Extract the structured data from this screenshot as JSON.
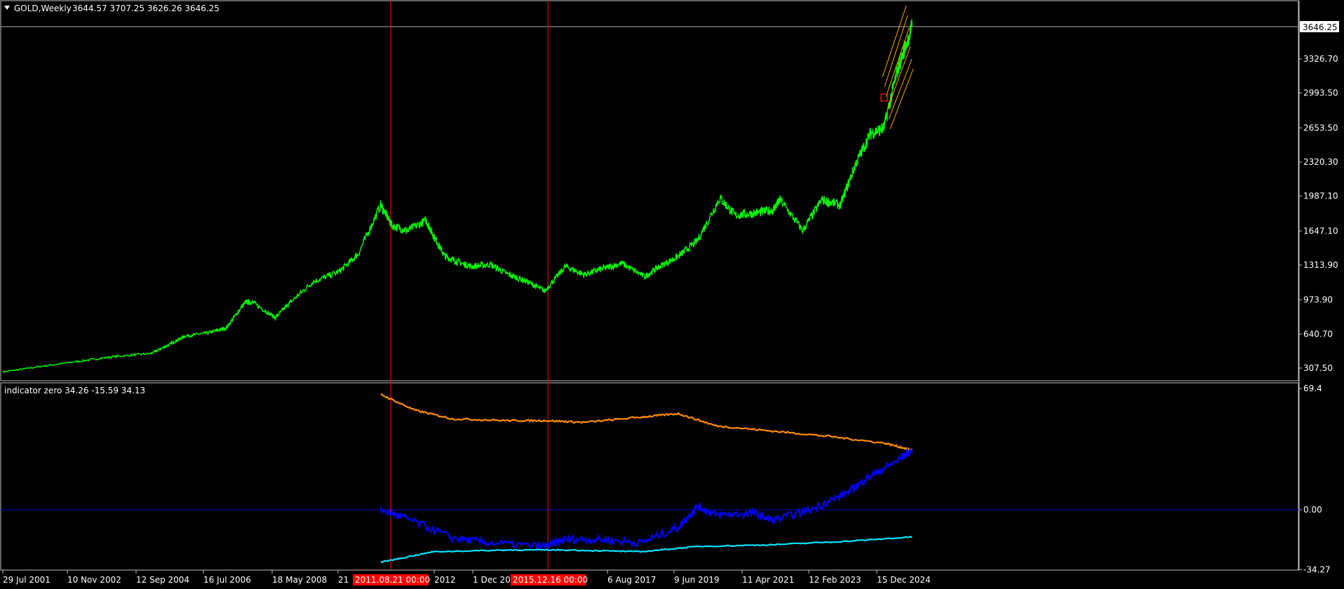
{
  "main_chart": {
    "symbol_label": "GOLD,Weekly",
    "ohlc_label": "3644.57 3707.25 3626.26 3646.25",
    "current_price_label": "3646.25",
    "price_ticks": [
      "3326.70",
      "2993.50",
      "2653.50",
      "2320.30",
      "1987.10",
      "1647.10",
      "1313.90",
      "973.90",
      "640.70",
      "307.50"
    ],
    "price_tick_values": [
      3326.7,
      2993.5,
      2653.5,
      2320.3,
      1987.1,
      1647.1,
      1313.9,
      973.9,
      640.7,
      307.5
    ],
    "colors": {
      "background": "#000000",
      "price": "#00ff00",
      "channel": "#ffa500",
      "vline": "#ff0000",
      "marker": "#cc2200",
      "frame": "#c0c0c0"
    }
  },
  "indicator": {
    "label": "indicator zero 34.26 -15.59 34.13",
    "ticks": [
      "69.4",
      "0.00",
      "-34.27"
    ],
    "tick_values": [
      69.4,
      0.0,
      -34.27
    ],
    "colors": {
      "orange": "#ff8c00",
      "blue": "#0000ff",
      "cyan": "#00e5ff",
      "zero_line": "#0000c8"
    }
  },
  "time_axis": {
    "labels": [
      "29 Jul 2001",
      "10 Nov 2002",
      "12 Sep 2004",
      "16 Jul 2006",
      "18 May 2008",
      "21",
      "2012",
      "1 Dec 20",
      "6 Aug 2017",
      "9 Jun 2019",
      "11 Apr 2021",
      "12 Feb 2023",
      "15 Dec 2024"
    ],
    "highlight_labels": [
      "2011.08.21 00:00",
      "2015.12.16 00:00"
    ],
    "highlight_color": "#ff0000"
  },
  "chart_data": [
    {
      "type": "line",
      "title": "GOLD,Weekly",
      "series": [
        {
          "name": "GOLD,Weekly",
          "x": [
            2001.57,
            2002.5,
            2003.5,
            2004.5,
            2005.5,
            2006.0,
            2006.4,
            2007.0,
            2007.5,
            2008.0,
            2008.2,
            2008.8,
            2009.2,
            2009.8,
            2010.5,
            2011.0,
            2011.6,
            2011.9,
            2012.3,
            2012.8,
            2013.0,
            2013.3,
            2013.6,
            2014.0,
            2014.5,
            2015.0,
            2015.5,
            2015.95,
            2016.5,
            2017.0,
            2017.5,
            2018.0,
            2018.6,
            2019.0,
            2019.5,
            2020.0,
            2020.6,
            2021.0,
            2021.5,
            2022.0,
            2022.2,
            2022.8,
            2023.3,
            2023.8,
            2024.2,
            2024.6,
            2024.95,
            2025.3,
            2025.7
          ],
          "values": [
            270,
            320,
            370,
            420,
            450,
            540,
            620,
            650,
            700,
            950,
            950,
            800,
            950,
            1150,
            1250,
            1420,
            1900,
            1700,
            1650,
            1750,
            1600,
            1400,
            1350,
            1300,
            1320,
            1220,
            1150,
            1060,
            1300,
            1220,
            1280,
            1330,
            1200,
            1300,
            1400,
            1550,
            1970,
            1800,
            1820,
            1850,
            1950,
            1650,
            1950,
            1900,
            2300,
            2600,
            2650,
            3200,
            3646
          ]
        }
      ],
      "ylim": [
        250,
        3800
      ]
    },
    {
      "type": "line",
      "title": "indicator zero",
      "series": [
        {
          "name": "",
          "x": [
            2011.6,
            2012.5,
            2013.5,
            2015.0,
            2016.0,
            2017.0,
            2018.5,
            2019.5,
            2020.5,
            2022.0,
            2023.5,
            2025.0,
            2025.7
          ],
          "values": [
            66,
            57,
            52,
            51,
            51,
            50,
            53,
            55,
            48,
            45,
            42,
            38,
            34.13
          ]
        },
        {
          "name": "",
          "x": [
            2011.6,
            2012.3,
            2013.5,
            2014.5,
            2015.95,
            2016.5,
            2017.5,
            2018.5,
            2019.5,
            2020.0,
            2020.5,
            2021.5,
            2022.0,
            2023.0,
            2024.0,
            2024.5,
            2025.3,
            2025.7
          ],
          "values": [
            0,
            -5,
            -16,
            -19,
            -21,
            -17,
            -17,
            -19,
            -10,
            2,
            -3,
            -2,
            -6,
            0,
            10,
            18,
            28,
            34.26
          ]
        },
        {
          "name": "",
          "x": [
            2011.6,
            2013.0,
            2015.0,
            2016.5,
            2018.5,
            2020.0,
            2022.0,
            2024.0,
            2025.7
          ],
          "values": [
            -30,
            -24,
            -23,
            -23,
            -24,
            -21,
            -20,
            -18,
            -15.59
          ]
        }
      ],
      "ylim": [
        -34.27,
        69.4
      ]
    }
  ]
}
